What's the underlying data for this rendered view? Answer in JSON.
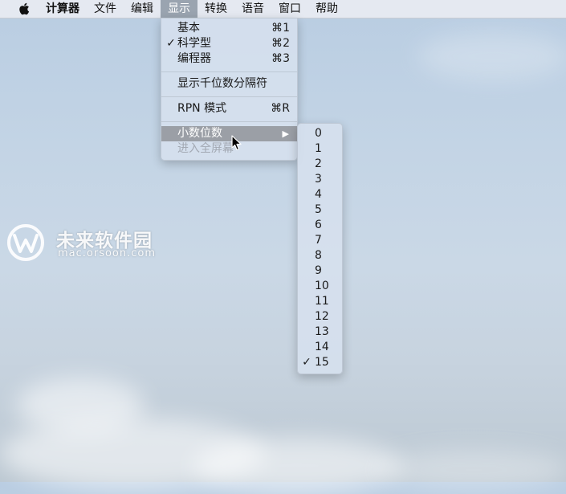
{
  "menubar": {
    "apple_icon": "apple-logo-icon",
    "items": [
      "计算器",
      "文件",
      "编辑",
      "显示",
      "转换",
      "语音",
      "窗口",
      "帮助"
    ],
    "active_index": 3
  },
  "view_menu": {
    "basic": {
      "label": "基本",
      "shortcut": "⌘1",
      "checked": false
    },
    "scientific": {
      "label": "科学型",
      "shortcut": "⌘2",
      "checked": true
    },
    "programmer": {
      "label": "编程器",
      "shortcut": "⌘3",
      "checked": false
    },
    "thousands_separator": {
      "label": "显示千位数分隔符"
    },
    "rpn_mode": {
      "label": "RPN 模式",
      "shortcut": "⌘R"
    },
    "decimal_places": {
      "label": "小数位数",
      "submenu_arrow": "▶"
    },
    "enter_fullscreen": {
      "label": "进入全屏幕",
      "disabled": true
    }
  },
  "decimal_submenu": {
    "options": [
      "0",
      "1",
      "2",
      "3",
      "4",
      "5",
      "6",
      "7",
      "8",
      "9",
      "10",
      "11",
      "12",
      "13",
      "14",
      "15"
    ],
    "selected": "15",
    "check_mark": "✓"
  },
  "watermark": {
    "title": "未来软件园",
    "url": "mac.orsoon.com"
  },
  "colors": {
    "highlight": "#9b9fa6",
    "menu_background": "#d6e0ee",
    "disabled_text": "#a3a9b3"
  }
}
